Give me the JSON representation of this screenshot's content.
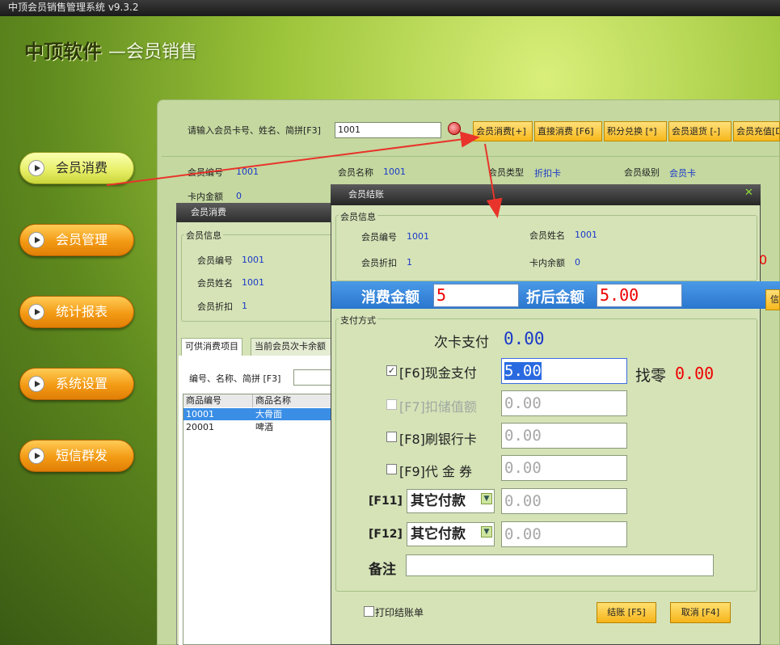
{
  "app": {
    "title": "中顶会员销售管理系统 v9.3.2"
  },
  "brand": {
    "name": "中顶软件",
    "subtitle": "—会员销售"
  },
  "nav": {
    "items": [
      {
        "label": "会员消费"
      },
      {
        "label": "会员管理"
      },
      {
        "label": "统计报表"
      },
      {
        "label": "系统设置"
      },
      {
        "label": "短信群发"
      }
    ]
  },
  "search": {
    "label": "请输入会员卡号、姓名、简拼[F3]",
    "value": "1001"
  },
  "toolbar": {
    "buttons": [
      "会员消费[+]",
      "直接消费 [F6]",
      "积分兑换 [*]",
      "会员退货 [-]",
      "会员充值[D"
    ]
  },
  "member_header": {
    "no_label": "会员编号",
    "no": "1001",
    "name_label": "会员名称",
    "name": "1001",
    "type_label": "会员类型",
    "type": "折扣卡",
    "level_label": "会员级别",
    "level": "会员卡",
    "balance_label": "卡内金额",
    "balance": "0"
  },
  "consume_window": {
    "title": "会员消费",
    "group_title": "会员信息",
    "no_label": "会员编号",
    "no": "1001",
    "name_label": "会员姓名",
    "name": "1001",
    "discount_label": "会员折扣",
    "discount": "1",
    "tabs": [
      "可供消费项目",
      "当前会员次卡余额"
    ],
    "filter_label": "编号、名称、简拼 [F3]",
    "columns": [
      "商品编号",
      "商品名称"
    ],
    "rows": [
      {
        "code": "10001",
        "name": "大骨面"
      },
      {
        "code": "20001",
        "name": "啤酒"
      }
    ]
  },
  "checkout": {
    "title": "会员结账",
    "info_title": "会员信息",
    "no_label": "会员编号",
    "no": "1001",
    "name_label": "会员姓名",
    "name": "1001",
    "discount_label": "会员折扣",
    "discount": "1",
    "balance_label": "卡内余额",
    "balance": "0",
    "amount_label": "消费金额",
    "amount": "5",
    "discounted_label": "折后金额",
    "discounted": "5.00",
    "payment_title": "支付方式",
    "card_times_label": "次卡支付",
    "card_times": "0.00",
    "cash_label": "[F6]现金支付",
    "cash": "5.00",
    "change_label": "找零",
    "change": "0.00",
    "stored_label": "[F7]扣储值额",
    "stored": "0.00",
    "bankcard_label": "[F8]刷银行卡",
    "bankcard": "0.00",
    "voucher_label": "[F9]代 金 券",
    "voucher": "0.00",
    "f11_label": "[F11]",
    "f11_select": "其它付款",
    "f11": "0.00",
    "f12_label": "[F12]",
    "f12_select": "其它付款",
    "f12": "0.00",
    "remark_label": "备注",
    "remark": "",
    "print_label": "打印结账单",
    "confirm_label": "结账 [F5]",
    "cancel_label": "取消 [F4]"
  },
  "colors": {
    "accent": "#f7b81c",
    "blue": "#2a76cf",
    "value": "#1a38c8",
    "red": "#e00000"
  }
}
